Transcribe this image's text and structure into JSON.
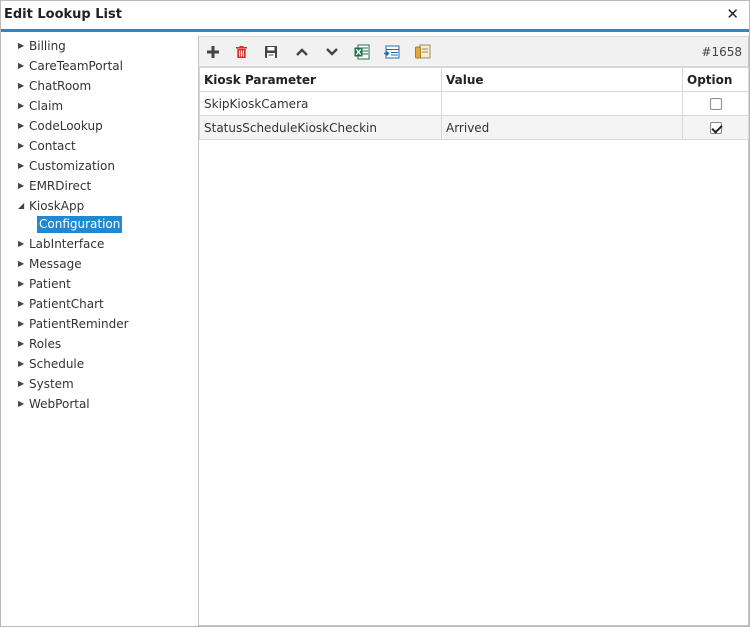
{
  "window": {
    "title": "Edit Lookup List",
    "close_label": "✕"
  },
  "tree": {
    "items": [
      {
        "label": "Billing",
        "expanded": false
      },
      {
        "label": "CareTeamPortal",
        "expanded": false
      },
      {
        "label": "ChatRoom",
        "expanded": false
      },
      {
        "label": "Claim",
        "expanded": false
      },
      {
        "label": "CodeLookup",
        "expanded": false
      },
      {
        "label": "Contact",
        "expanded": false
      },
      {
        "label": "Customization",
        "expanded": false
      },
      {
        "label": "EMRDirect",
        "expanded": false
      },
      {
        "label": "KioskApp",
        "expanded": true,
        "children": [
          {
            "label": "Configuration",
            "selected": true
          }
        ]
      },
      {
        "label": "LabInterface",
        "expanded": false
      },
      {
        "label": "Message",
        "expanded": false
      },
      {
        "label": "Patient",
        "expanded": false
      },
      {
        "label": "PatientChart",
        "expanded": false
      },
      {
        "label": "PatientReminder",
        "expanded": false
      },
      {
        "label": "Roles",
        "expanded": false
      },
      {
        "label": "Schedule",
        "expanded": false
      },
      {
        "label": "System",
        "expanded": false
      },
      {
        "label": "WebPortal",
        "expanded": false
      }
    ]
  },
  "toolbar": {
    "buttons": [
      {
        "icon": "plus-icon"
      },
      {
        "icon": "trash-icon"
      },
      {
        "icon": "save-icon"
      },
      {
        "icon": "move-up-icon"
      },
      {
        "icon": "move-down-icon"
      },
      {
        "icon": "excel-export-icon"
      },
      {
        "icon": "grid-export-icon"
      },
      {
        "icon": "import-icon"
      }
    ],
    "record_id": "#1658"
  },
  "grid": {
    "columns": [
      "Kiosk Parameter",
      "Value",
      "Option"
    ],
    "rows": [
      {
        "parameter": "SkipKioskCamera",
        "value": "",
        "option": false
      },
      {
        "parameter": "StatusScheduleKioskCheckin",
        "value": "Arrived",
        "option": true
      }
    ]
  },
  "colors": {
    "accent": "#1f8ad3",
    "delete": "#d9302c",
    "excel": "#1e7145"
  }
}
